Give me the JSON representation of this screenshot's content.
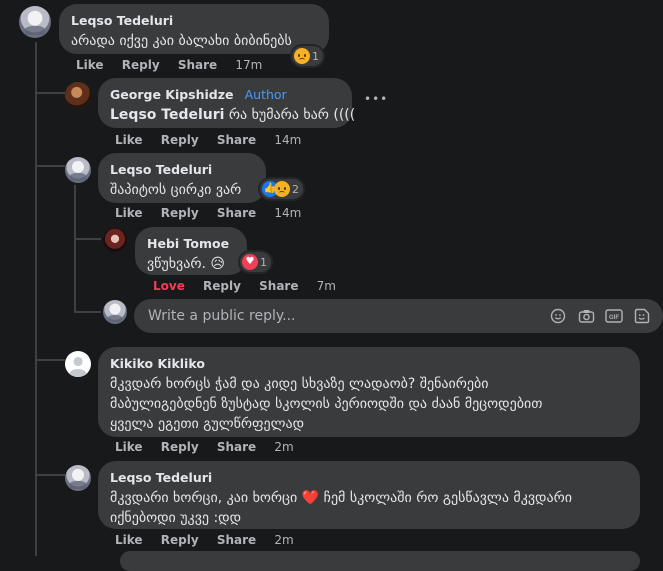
{
  "comments": {
    "c1": {
      "author": "Leqso Tedeluri",
      "text": "არადა იქვე კაი ბალახი ბიბინებს",
      "reaction_count": "1",
      "actions": {
        "like": "Like",
        "reply": "Reply",
        "share": "Share",
        "time": "17m"
      }
    },
    "c2": {
      "author": "George Kipshidze",
      "badge": "Author",
      "mention": "Leqso Tedeluri",
      "text": " რა ხუმარა ხარ ((((",
      "more": "•••",
      "actions": {
        "like": "Like",
        "reply": "Reply",
        "share": "Share",
        "time": "14m"
      }
    },
    "c3": {
      "author": "Leqso Tedeluri",
      "text": "შაპიტოს ცირკი ვარ",
      "reaction_count": "2",
      "actions": {
        "like": "Like",
        "reply": "Reply",
        "share": "Share",
        "time": "14m"
      }
    },
    "c4": {
      "author": "Hebi Tomoe",
      "text": "ვწუხვარ. 😥",
      "reaction_count": "1",
      "actions": {
        "love": "Love",
        "reply": "Reply",
        "share": "Share",
        "time": "7m"
      }
    },
    "c5": {
      "author": "Kikiko Kikliko",
      "text_lines": [
        "მკვდარ ხორცს ჭამ და კიდე სხვაზე ლადაობ? შენაირები",
        "მაბულიგებდნენ ზუსტად სკოლის პერიოდში და ძაან მეცოდებით",
        "ყველა ეგეთი გულწრფელად"
      ],
      "actions": {
        "like": "Like",
        "reply": "Reply",
        "share": "Share",
        "time": "2m"
      }
    },
    "c6": {
      "author": "Leqso Tedeluri",
      "text_lines": [
        "მკვდარი ხორცი, კაი ხორცი ❤️ ჩემ სკოლაში რო გესწავლა მკვდარი",
        "იქნებოდი უკვე :დდ"
      ],
      "actions": {
        "like": "Like",
        "reply": "Reply",
        "share": "Share",
        "time": "2m"
      }
    }
  },
  "reply_box": {
    "placeholder": "Write a public reply...",
    "icons": [
      "emoji-icon",
      "camera-icon",
      "gif-icon",
      "sticker-icon"
    ]
  },
  "colors": {
    "background": "#18191a",
    "bubble": "#3a3b3c",
    "text": "#e4e6eb",
    "secondary": "#b0b3b8",
    "author_badge": "#4599ff",
    "love": "#f33e58"
  }
}
